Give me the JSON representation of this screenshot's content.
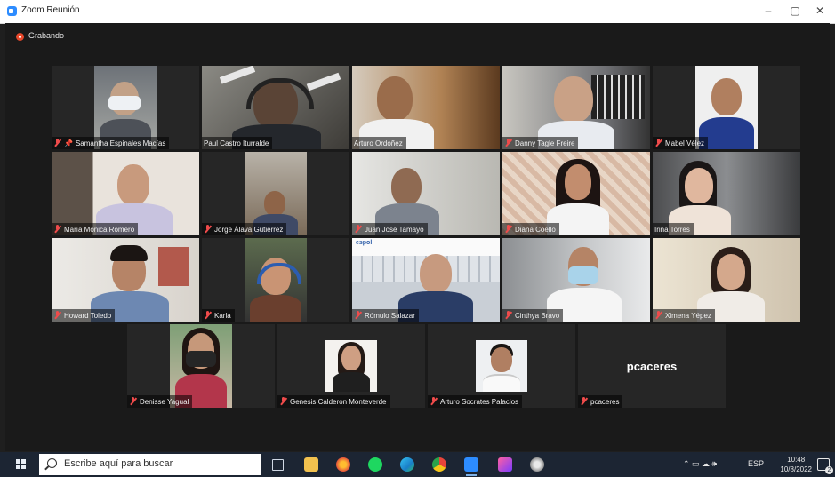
{
  "window": {
    "title": "Zoom Reunión",
    "minimize_label": "–",
    "restore_label": "▢",
    "close_label": "✕"
  },
  "recording": {
    "label": "Grabando"
  },
  "participants": [
    {
      "name": "Samantha Espinales Macías",
      "muted": true,
      "pinned": true
    },
    {
      "name": "Paul Castro Iturralde",
      "muted": false,
      "active_speaker": true
    },
    {
      "name": "Arturo Ordoñez",
      "muted": false
    },
    {
      "name": "Danny Tagle Freire",
      "muted": true
    },
    {
      "name": "Mabel Vélez",
      "muted": true
    },
    {
      "name": "María Mónica Romero",
      "muted": true
    },
    {
      "name": "Jorge Álava Gutiérrez",
      "muted": true
    },
    {
      "name": "Juan José Tamayo",
      "muted": true
    },
    {
      "name": "Diana Coello",
      "muted": true
    },
    {
      "name": "Irina Torres",
      "muted": false
    },
    {
      "name": "Howard Toledo",
      "muted": true
    },
    {
      "name": "Karla",
      "muted": true
    },
    {
      "name": "Rómulo Salazar",
      "muted": true
    },
    {
      "name": "Cinthya Bravo",
      "muted": true
    },
    {
      "name": "Ximena Yépez",
      "muted": true
    },
    {
      "name": "Denisse Yagual",
      "muted": true
    },
    {
      "name": "Genesis Calderon Monteverde",
      "muted": true
    },
    {
      "name": "Arturo Socrates Palacios",
      "muted": true
    },
    {
      "name": "pcaceres",
      "muted": true,
      "no_video": true,
      "display_name": "pcaceres"
    }
  ],
  "taskbar": {
    "search_placeholder": "Escribe aquí para buscar",
    "language": "ESP",
    "time": "10:48",
    "date": "10/8/2022",
    "notifications": "2",
    "tray_icons": "⌃ ▭ ☁ 🕪",
    "pinned_apps": [
      "task-view",
      "file-explorer",
      "firefox",
      "spotify",
      "edge",
      "chrome",
      "zoom",
      "camera",
      "paint"
    ]
  },
  "colors": {
    "accent": "#2d8cff",
    "active_speaker_border": "#c9d84b",
    "muted_mic": "#ef4b4b",
    "taskbar": "#1c2533"
  }
}
